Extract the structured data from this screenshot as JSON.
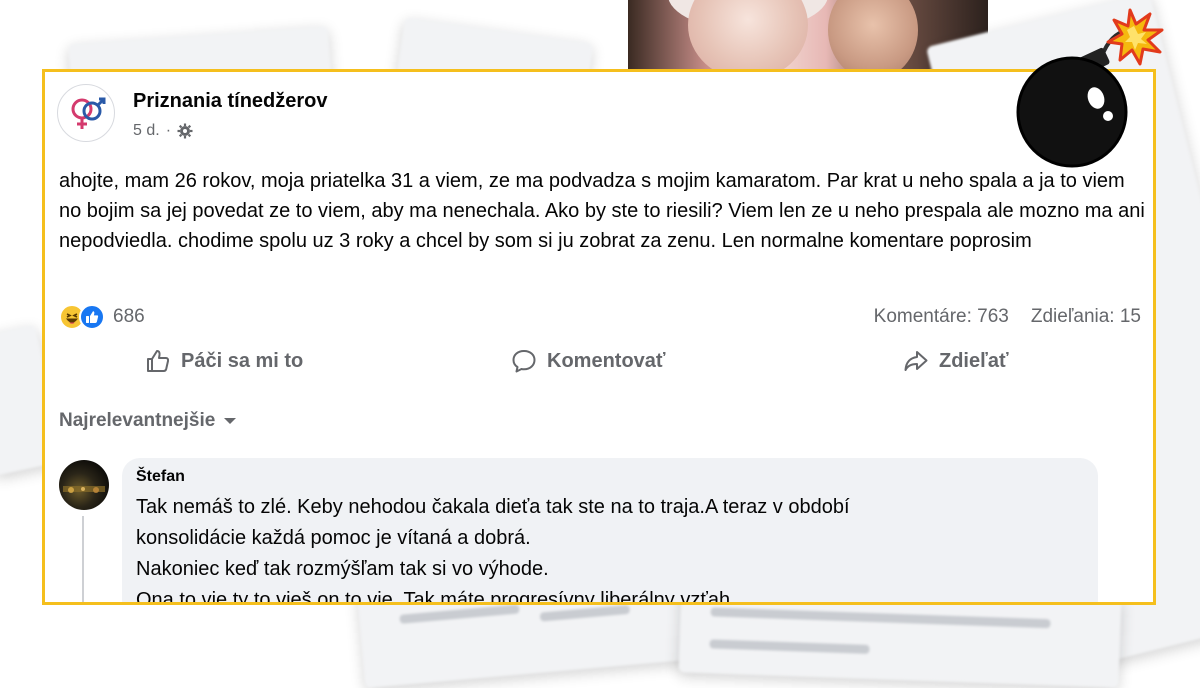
{
  "post": {
    "page_name": "Priznania tínedžerov",
    "time": "5 d.",
    "separator": "·",
    "text": "ahojte, mam 26 rokov, moja priatelka 31 a viem, ze ma podvadza s mojim kamaratom. Par krat u neho spala a ja to viem no bojim sa jej povedat ze to viem, aby ma nenechala. Ako by ste to riesili? Viem len ze u neho prespala ale mozno ma ani nepodviedla. chodime spolu uz 3 roky a chcel by som si ju zobrat za zenu. Len normalne komentare poprosim",
    "reactions": {
      "count": "686",
      "icons": [
        "haha-icon",
        "like-icon"
      ]
    },
    "comments_count": "Komentáre: 763",
    "shares_count": "Zdieľania: 15"
  },
  "actions": {
    "like": "Páči sa mi to",
    "comment": "Komentovať",
    "share": "Zdieľať"
  },
  "sort": {
    "label": "Najrelevantnejšie"
  },
  "comment": {
    "author": "Štefan",
    "lines": [
      "Tak nemáš to zlé. Keby nehodou čakala dieťa tak ste na to traja.A teraz v období",
      "konsolidácie každá pomoc je vítaná a dobrá.",
      "Nakoniec keď tak rozmýšľam tak si vo výhode.",
      "Ona to vie ty to vieš on to vie. Tak máte progresívny liberálny vzťah"
    ]
  },
  "colors": {
    "frame": "#f5bf1d",
    "like_blue": "#1877f2",
    "haha_yellow": "#f7c533",
    "secondary_text": "#65676b",
    "bubble_bg": "#f0f2f5"
  }
}
